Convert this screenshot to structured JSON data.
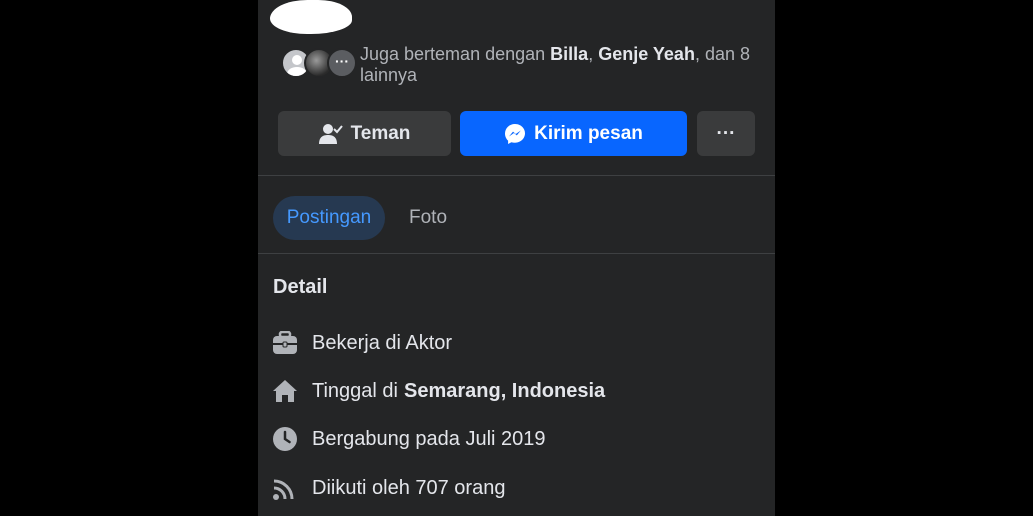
{
  "mutual": {
    "prefix": "Juga berteman dengan",
    "friend1": "Billa",
    "friend2": "Genje Yeah",
    "suffix": ", dan 8 lainnya",
    "more_avatar": "···"
  },
  "actions": {
    "friend_label": "Teman",
    "message_label": "Kirim pesan",
    "more_label": "···"
  },
  "tabs": [
    {
      "label": "Postingan",
      "active": true
    },
    {
      "label": "Foto",
      "active": false
    }
  ],
  "details": {
    "title": "Detail",
    "work": "Bekerja di Aktor",
    "lives_prefix": "Tinggal di",
    "lives_place": "Semarang, Indonesia",
    "joined": "Bergabung pada Juli 2019",
    "followers": "Diikuti oleh 707 orang"
  },
  "colors": {
    "background": "#242526",
    "primary_button": "#0866ff",
    "secondary_button": "#3a3b3c",
    "active_tab_bg": "#263951",
    "active_tab_text": "#4599ff"
  },
  "icons": [
    "person-check-icon",
    "messenger-icon",
    "more-icon",
    "briefcase-icon",
    "home-icon",
    "clock-icon",
    "rss-icon"
  ]
}
